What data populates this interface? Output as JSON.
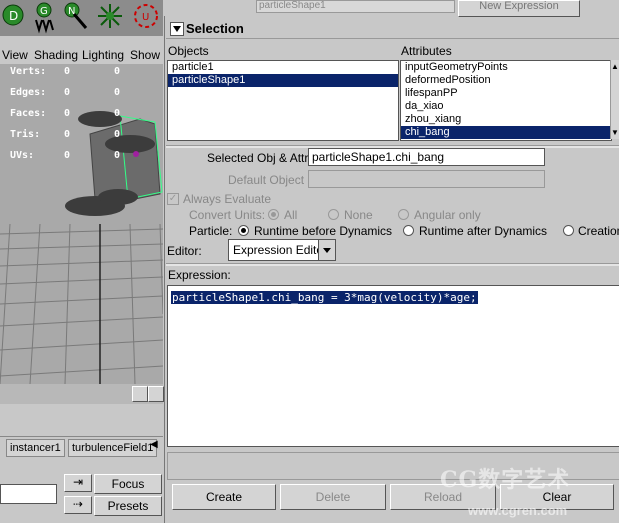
{
  "left_panel": {
    "viewport_menu": [
      "View",
      "Shading",
      "Lighting",
      "Show"
    ],
    "hud": [
      {
        "label": "Verts:",
        "v1": "0",
        "v2": "0"
      },
      {
        "label": "Edges:",
        "v1": "0",
        "v2": "0"
      },
      {
        "label": "Faces:",
        "v1": "0",
        "v2": "0"
      },
      {
        "label": "Tris:",
        "v1": "0",
        "v2": "0"
      },
      {
        "label": "UVs:",
        "v1": "0",
        "v2": "0"
      }
    ],
    "tabs": [
      "instancer1",
      "turbulenceField1"
    ],
    "focus_button": "Focus",
    "presets_button": "Presets"
  },
  "header": {
    "expression_name_value": "particleShape1",
    "new_expression_button": "New Expression"
  },
  "selection": {
    "title": "Selection",
    "objects_label": "Objects",
    "attributes_label": "Attributes",
    "objects": [
      "particle1",
      "particleShape1"
    ],
    "objects_selected": "particleShape1",
    "attributes": [
      "inputGeometryPoints",
      "deformedPosition",
      "lifespanPP",
      "da_xiao",
      "zhou_xiang",
      "chi_bang"
    ],
    "attributes_selected": "chi_bang"
  },
  "form": {
    "selected_obj_attr_label": "Selected Obj & Attr",
    "selected_obj_attr_value": "particleShape1.chi_bang",
    "default_object_label": "Default Object",
    "always_evaluate_label": "Always Evaluate",
    "convert_units_label": "Convert Units:",
    "convert_all": "All",
    "convert_none": "None",
    "convert_angular": "Angular only",
    "particle_label": "Particle:",
    "runtime_before": "Runtime before Dynamics",
    "runtime_after": "Runtime after Dynamics",
    "creation": "Creation",
    "editor_label": "Editor:",
    "editor_value": "Expression Editor",
    "expression_label": "Expression:",
    "expression_text": "particleShape1.chi_bang = 3*mag(velocity)*age;"
  },
  "buttons": {
    "create": "Create",
    "delete": "Delete",
    "reload": "Reload",
    "clear": "Clear"
  },
  "watermark": {
    "text": "CG数字艺术",
    "url": "www.cgren.com"
  },
  "colors": {
    "selection": "#0a246a",
    "panel": "#c8c8c8",
    "viewport": "#a9a9a9",
    "wire_green": "#33ff88"
  }
}
